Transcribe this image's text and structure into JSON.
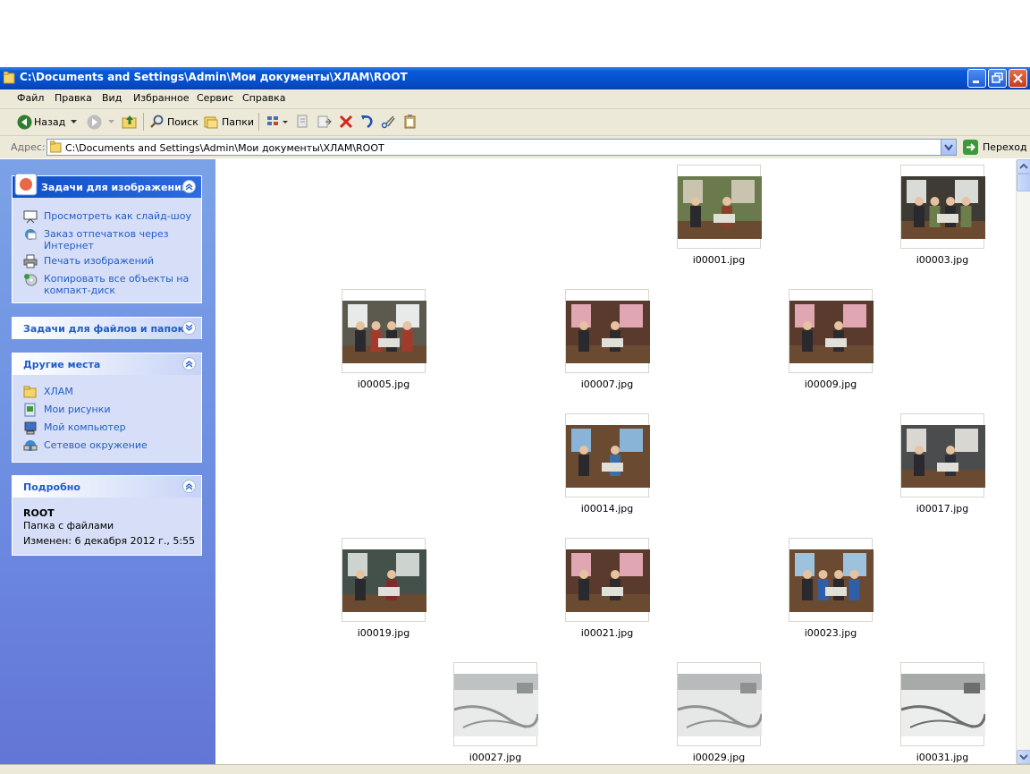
{
  "window": {
    "title": "C:\\Documents and Settings\\Admin\\Мои документы\\ХЛАМ\\ROOT"
  },
  "menubar": {
    "items": [
      "Файл",
      "Правка",
      "Вид",
      "Избранное",
      "Сервис",
      "Справка"
    ]
  },
  "toolbar": {
    "back_label": "Назад",
    "search_label": "Поиск",
    "folders_label": "Папки"
  },
  "address": {
    "label": "Адрес:",
    "value": "C:\\Documents and Settings\\Admin\\Мои документы\\ХЛАМ\\ROOT",
    "go_label": "Переход"
  },
  "left_panel": {
    "image_tasks": {
      "title": "Задачи для изображений",
      "items": [
        {
          "label": "Просмотреть как слайд-шоу",
          "icon": "slideshow-icon"
        },
        {
          "label": "Заказ отпечатков через",
          "label2": "Интернет",
          "icon": "order-prints-icon"
        },
        {
          "label": "Печать изображений",
          "icon": "printer-icon"
        },
        {
          "label": "Копировать все объекты на",
          "label2": "компакт-диск",
          "icon": "cd-copy-icon"
        }
      ]
    },
    "file_tasks": {
      "title": "Задачи для файлов и папок"
    },
    "other_places": {
      "title": "Другие места",
      "items": [
        {
          "label": "ХЛАМ",
          "icon": "folder-icon"
        },
        {
          "label": "Мои рисунки",
          "icon": "my-pictures-icon"
        },
        {
          "label": "Мой компьютер",
          "icon": "my-computer-icon"
        },
        {
          "label": "Сетевое окружение",
          "icon": "network-icon"
        }
      ]
    },
    "details": {
      "title": "Подробно",
      "name": "ROOT",
      "type": "Папка с файлами",
      "modified": "Изменен: 6 декабря 2012 г., 5:55"
    }
  },
  "files": [
    {
      "name": "i00001.jpg",
      "scene": "office",
      "colors": [
        "#6b7a4c",
        "#c9c3b0",
        "#8a3f2a"
      ]
    },
    {
      "name": "i00003.jpg",
      "scene": "people",
      "colors": [
        "#3e3a34",
        "#d9dcd6",
        "#6d7d4b"
      ]
    },
    {
      "name": "i00005.jpg",
      "scene": "people",
      "colors": [
        "#5c5a4e",
        "#e8eaea",
        "#a33b2c"
      ]
    },
    {
      "name": "i00007.jpg",
      "scene": "office",
      "colors": [
        "#5a3a2c",
        "#e0a6b2",
        "#2d2b2e"
      ]
    },
    {
      "name": "i00009.jpg",
      "scene": "office",
      "colors": [
        "#5a3a2c",
        "#e0a6b2",
        "#2d2b2e"
      ]
    },
    {
      "name": "i00014.jpg",
      "scene": "office",
      "colors": [
        "#6a4a30",
        "#8ab3d8",
        "#3a6ea6"
      ]
    },
    {
      "name": "i00017.jpg",
      "scene": "office",
      "colors": [
        "#4b4c4e",
        "#d9d7d2",
        "#2c2f3a"
      ]
    },
    {
      "name": "i00019.jpg",
      "scene": "office",
      "colors": [
        "#44504a",
        "#cdd3cf",
        "#7f2c2c"
      ]
    },
    {
      "name": "i00021.jpg",
      "scene": "office",
      "colors": [
        "#5a3a2c",
        "#e0a6b2",
        "#2d2b2e"
      ]
    },
    {
      "name": "i00023.jpg",
      "scene": "people",
      "colors": [
        "#6a4a30",
        "#9fc2dc",
        "#2e5fa8"
      ]
    },
    {
      "name": "i00027.jpg",
      "scene": "snow",
      "colors": [
        "#bfc2c2",
        "#e9ebeb",
        "#8f9493"
      ]
    },
    {
      "name": "i00029.jpg",
      "scene": "snow",
      "colors": [
        "#b8bbbb",
        "#e6e7e7",
        "#8d9190"
      ]
    },
    {
      "name": "i00031.jpg",
      "scene": "snow",
      "colors": [
        "#a6aaa8",
        "#eceded",
        "#6b6f6b"
      ]
    }
  ]
}
